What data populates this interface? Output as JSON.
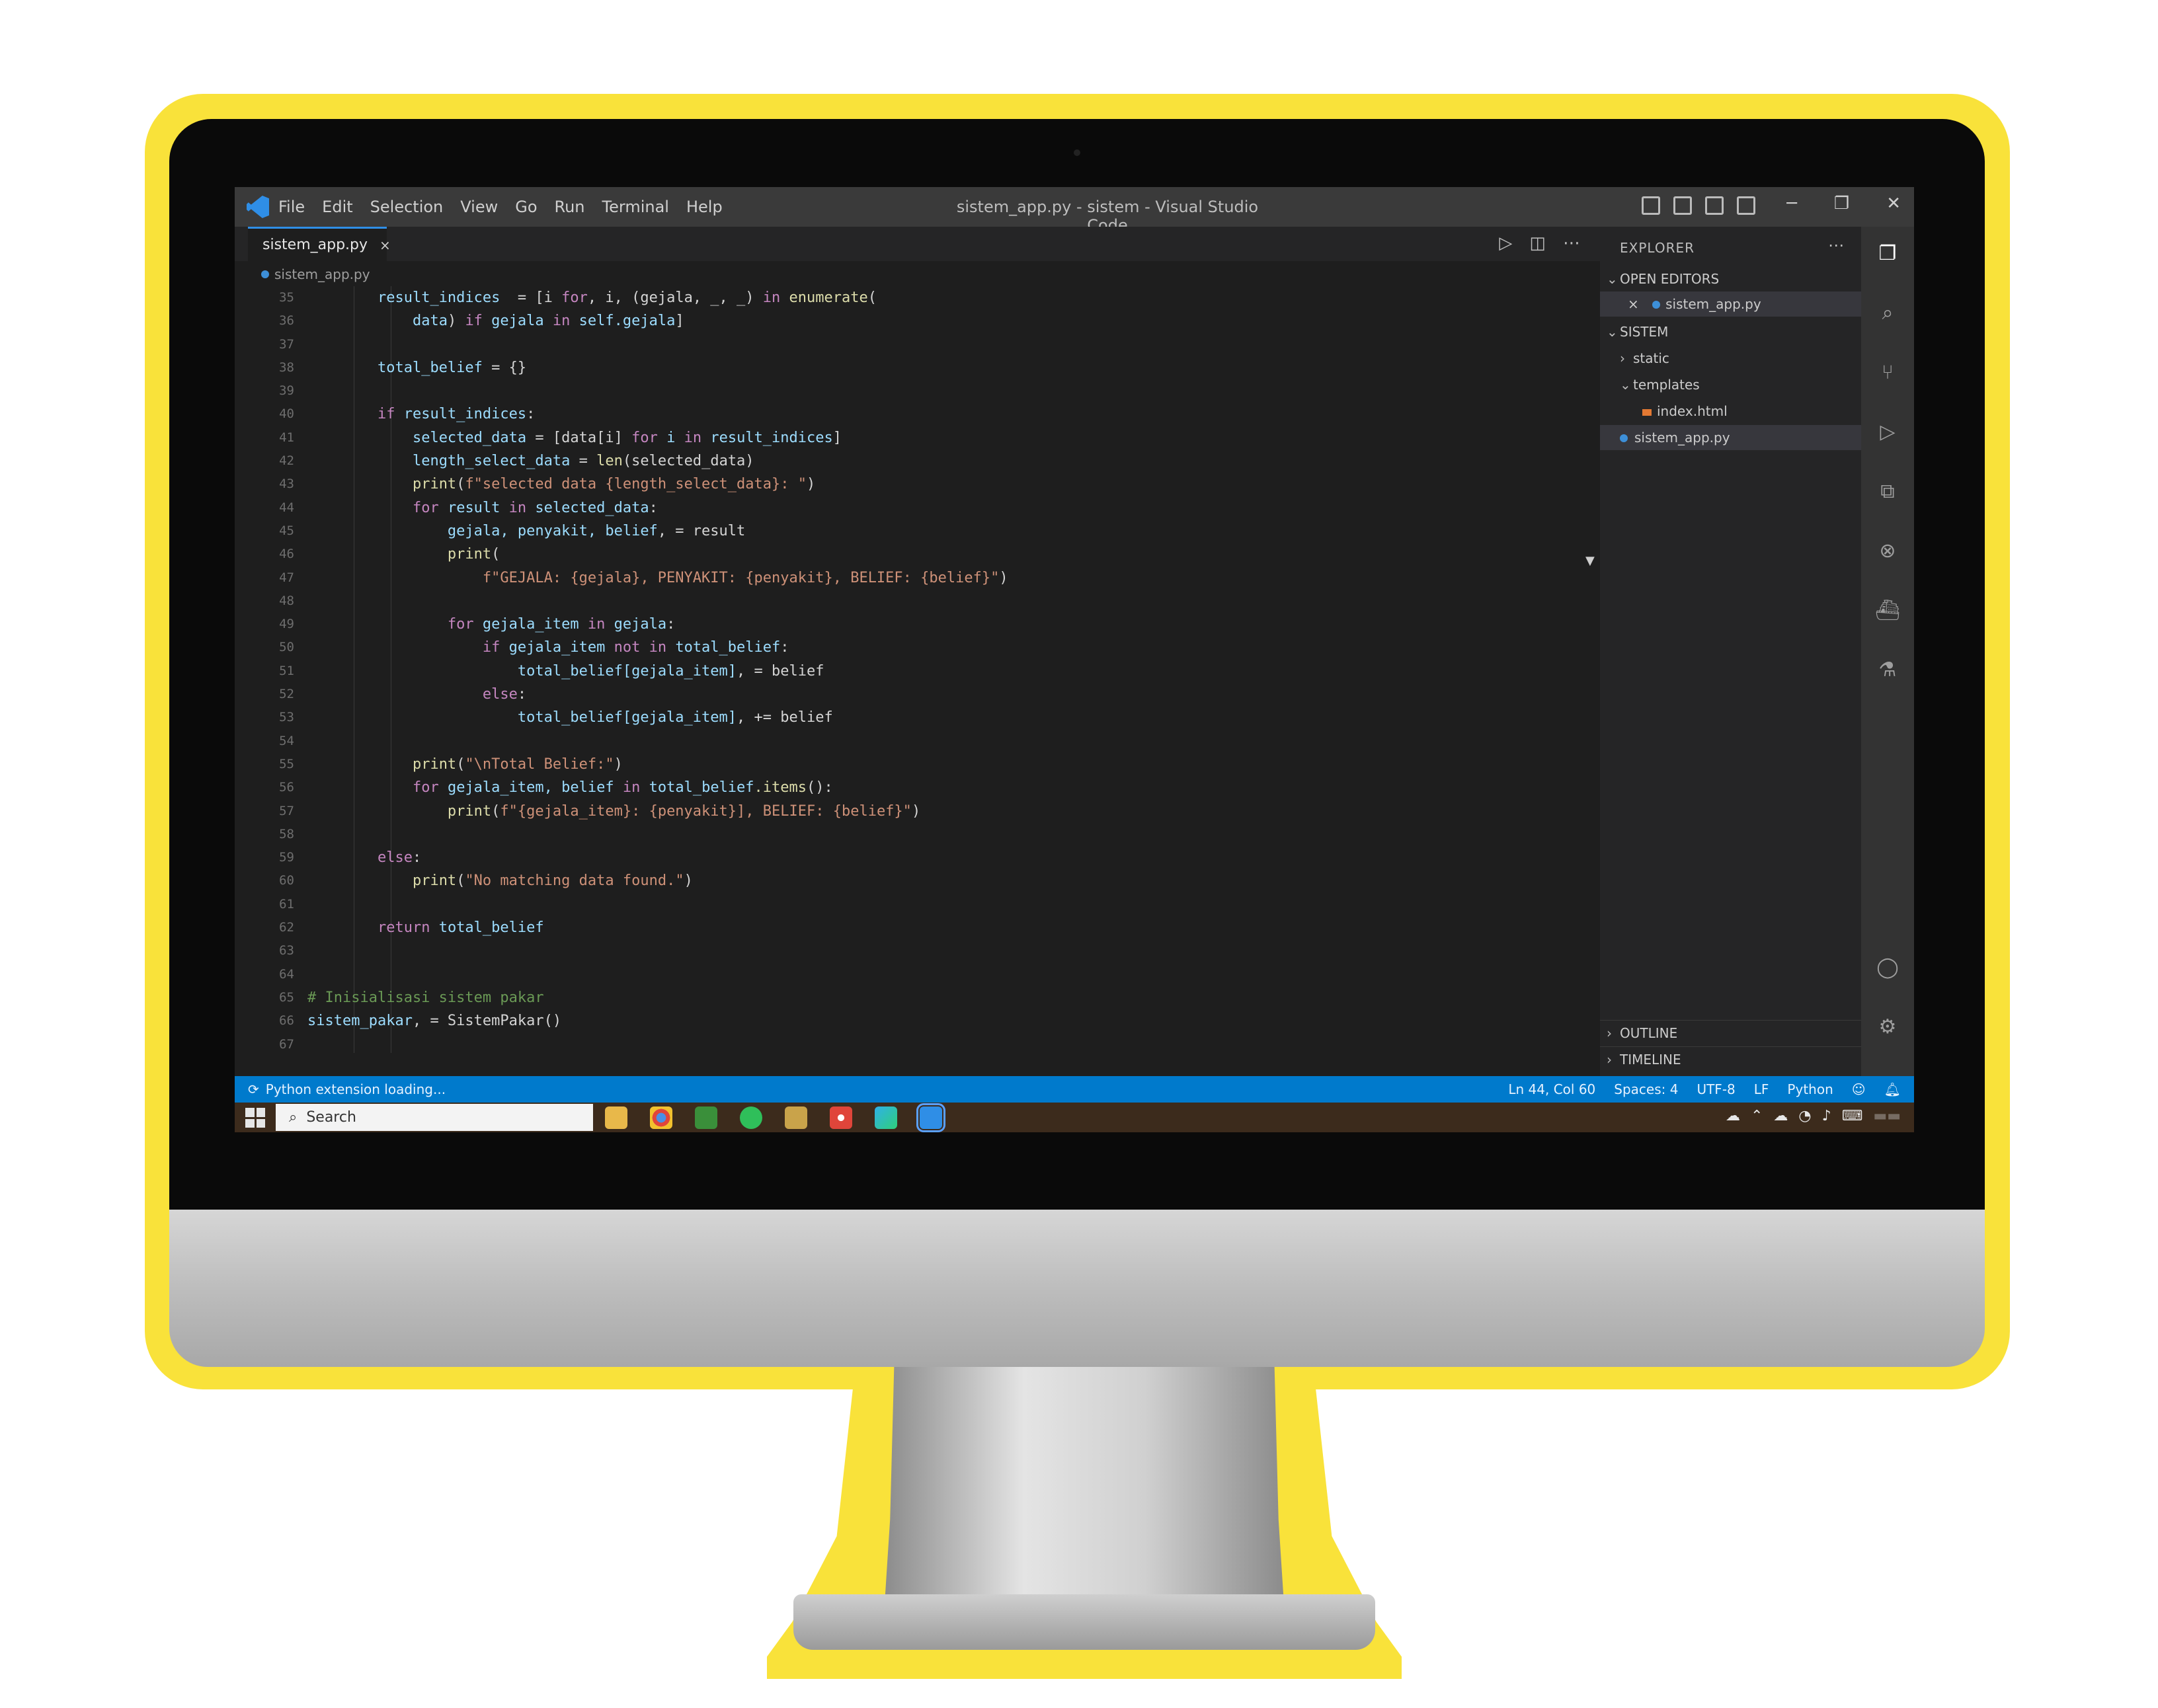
{
  "window": {
    "title": "sistem_app.py - sistem - Visual Studio Code",
    "menu": [
      "File",
      "Edit",
      "Selection",
      "View",
      "Go",
      "Run",
      "Terminal",
      "Help"
    ]
  },
  "tab": {
    "label": "sistem_app.py",
    "close": "×"
  },
  "breadcrumb": "sistem_app.py",
  "gutter": [
    "35",
    "36",
    "37",
    "38",
    "39",
    "40",
    "41",
    "42",
    "43",
    "44",
    "45",
    "46",
    "47",
    "48",
    "49",
    "50",
    "51",
    "52",
    "53",
    "54",
    "55",
    "56",
    "57",
    "58",
    "59",
    "60",
    "61",
    "62",
    "63",
    "64",
    "65",
    "66",
    "67"
  ],
  "code": [
    {
      "indent": "        ",
      "parts": [
        [
          "var",
          "result_indices"
        ],
        [
          "",
          "  = [i "
        ],
        [
          "kw",
          "for"
        ],
        [
          "",
          ", i, (gejala, _, _) "
        ],
        [
          "kw",
          "in"
        ],
        [
          "fn",
          " enumerate"
        ],
        [
          "",
          "("
        ]
      ]
    },
    {
      "indent": "            ",
      "parts": [
        [
          "var",
          "data"
        ],
        [
          "",
          ") "
        ],
        [
          "kw",
          "if"
        ],
        [
          "var",
          " gejala"
        ],
        [
          "kw",
          " in"
        ],
        [
          "var",
          " self.gejala"
        ],
        [
          "",
          "]"
        ]
      ]
    },
    {
      "indent": "",
      "parts": []
    },
    {
      "indent": "        ",
      "parts": [
        [
          "var",
          "total_belief"
        ],
        [
          "",
          " = {}"
        ]
      ]
    },
    {
      "indent": "",
      "parts": []
    },
    {
      "indent": "        ",
      "parts": [
        [
          "kw",
          "if"
        ],
        [
          "var",
          " result_indices"
        ],
        [
          "",
          ":"
        ]
      ]
    },
    {
      "indent": "            ",
      "parts": [
        [
          "var",
          "selected_data"
        ],
        [
          "",
          " = [data[i] "
        ],
        [
          "kw",
          "for"
        ],
        [
          "var",
          " i "
        ],
        [
          "kw",
          "in"
        ],
        [
          "var",
          " result_indices"
        ],
        [
          "",
          "]"
        ]
      ]
    },
    {
      "indent": "            ",
      "parts": [
        [
          "var",
          "length_select_data"
        ],
        [
          "",
          " = "
        ],
        [
          "fn",
          "len"
        ],
        [
          "",
          "(selected_data)"
        ]
      ]
    },
    {
      "indent": "            ",
      "parts": [
        [
          "fn",
          "print"
        ],
        [
          "",
          "("
        ],
        [
          "str",
          "f\"selected data {length_select_data}: \""
        ],
        [
          "",
          ")"
        ]
      ]
    },
    {
      "indent": "            ",
      "parts": [
        [
          "kw",
          "for"
        ],
        [
          "var",
          " result "
        ],
        [
          "kw",
          "in"
        ],
        [
          "var",
          " selected_data"
        ],
        [
          "",
          ":"
        ]
      ]
    },
    {
      "indent": "                ",
      "parts": [
        [
          "var",
          "gejala, penyakit, belief"
        ],
        [
          "",
          ", = result"
        ]
      ]
    },
    {
      "indent": "                ",
      "parts": [
        [
          "fn",
          "print"
        ],
        [
          "",
          "("
        ]
      ]
    },
    {
      "indent": "                    ",
      "parts": [
        [
          "str",
          "f\"GEJALA: {gejala}, PENYAKIT: {penyakit}, BELIEF: {belief}\""
        ],
        [
          "",
          ")"
        ]
      ]
    },
    {
      "indent": "",
      "parts": []
    },
    {
      "indent": "                ",
      "parts": [
        [
          "kw",
          "for"
        ],
        [
          "var",
          " gejala_item "
        ],
        [
          "kw",
          "in"
        ],
        [
          "var",
          " gejala"
        ],
        [
          "",
          ":"
        ]
      ]
    },
    {
      "indent": "                    ",
      "parts": [
        [
          "kw",
          "if"
        ],
        [
          "var",
          " gejala_item "
        ],
        [
          "kw",
          "not in"
        ],
        [
          "var",
          " total_belief"
        ],
        [
          "",
          ":"
        ]
      ]
    },
    {
      "indent": "                        ",
      "parts": [
        [
          "var",
          "total_belief[gejala_item]"
        ],
        [
          "",
          ", = belief"
        ]
      ]
    },
    {
      "indent": "                    ",
      "parts": [
        [
          "kw",
          "else"
        ],
        [
          "",
          ":"
        ]
      ]
    },
    {
      "indent": "                        ",
      "parts": [
        [
          "var",
          "total_belief[gejala_item]"
        ],
        [
          "",
          ", += belief"
        ]
      ]
    },
    {
      "indent": "",
      "parts": []
    },
    {
      "indent": "            ",
      "parts": [
        [
          "fn",
          "print"
        ],
        [
          "",
          "("
        ],
        [
          "str",
          "\"\\nTotal Belief:\""
        ],
        [
          "",
          ")"
        ]
      ]
    },
    {
      "indent": "            ",
      "parts": [
        [
          "kw",
          "for"
        ],
        [
          "var",
          " gejala_item, belief "
        ],
        [
          "kw",
          "in"
        ],
        [
          "var",
          " total_belief"
        ],
        [
          "fn",
          ".items"
        ],
        [
          "",
          "():"
        ]
      ]
    },
    {
      "indent": "                ",
      "parts": [
        [
          "fn",
          "print"
        ],
        [
          "",
          "("
        ],
        [
          "str",
          "f\"{gejala_item}: {penyakit}], BELIEF: {belief}\""
        ],
        [
          "",
          ")"
        ]
      ]
    },
    {
      "indent": "",
      "parts": []
    },
    {
      "indent": "        ",
      "parts": [
        [
          "kw",
          "else"
        ],
        [
          "",
          ":"
        ]
      ]
    },
    {
      "indent": "            ",
      "parts": [
        [
          "fn",
          "print"
        ],
        [
          "",
          "("
        ],
        [
          "str",
          "\"No matching data found.\""
        ],
        [
          "",
          ")"
        ]
      ]
    },
    {
      "indent": "",
      "parts": []
    },
    {
      "indent": "        ",
      "parts": [
        [
          "kw",
          "return"
        ],
        [
          "var",
          " total_belief"
        ]
      ]
    },
    {
      "indent": "",
      "parts": []
    },
    {
      "indent": "",
      "parts": []
    },
    {
      "indent": "",
      "parts": [
        [
          "cmt",
          "# Inisialisasi sistem pakar"
        ]
      ]
    },
    {
      "indent": "",
      "parts": [
        [
          "var",
          "sistem_pakar"
        ],
        [
          "",
          ", = SistemPakar()"
        ]
      ]
    }
  ],
  "explorer": {
    "title": "EXPLORER",
    "open_editors": "OPEN EDITORS",
    "open_file": "sistem_app.py",
    "folder": "SISTEM",
    "items": [
      {
        "label": "static",
        "kind": "folder"
      },
      {
        "label": "templates",
        "kind": "folder-open"
      },
      {
        "label": "index.html",
        "kind": "html"
      },
      {
        "label": "sistem_app.py",
        "kind": "py"
      }
    ],
    "outline": "OUTLINE",
    "timeline": "TIMELINE"
  },
  "statusbar": {
    "left": "Python extension loading...",
    "right": [
      "Ln 44, Col 60",
      "Spaces: 4",
      "UTF-8",
      "LF",
      "Python"
    ]
  },
  "taskbar": {
    "search_placeholder": "Search"
  },
  "colors": {
    "accent": "#007acc",
    "frame": "#f9e23a",
    "editor_bg": "#1e1e1e"
  }
}
